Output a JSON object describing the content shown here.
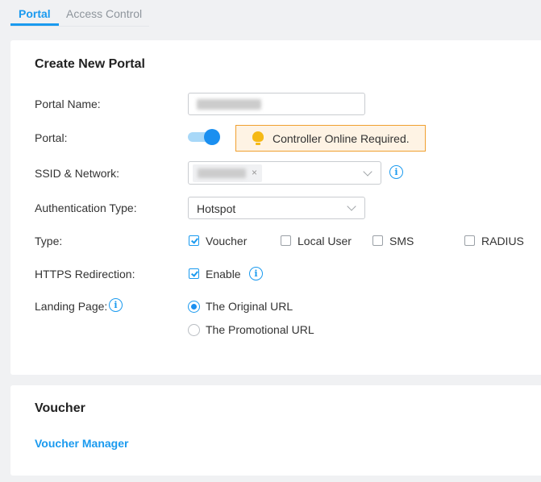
{
  "tabs": [
    {
      "label": "Portal",
      "active": true
    },
    {
      "label": "Access Control",
      "active": false
    }
  ],
  "create_portal": {
    "title": "Create New Portal",
    "portal_name": {
      "label": "Portal Name:",
      "value": "(blurred)"
    },
    "portal": {
      "label": "Portal:",
      "enabled": true,
      "warning": "Controller Online Required.",
      "warning_icon": "lightbulb-icon"
    },
    "ssid_network": {
      "label": "SSID & Network:",
      "selected_chips": [
        "(blurred)"
      ],
      "chip_remove": "×",
      "info_icon": "info-icon"
    },
    "auth_type": {
      "label": "Authentication Type:",
      "value": "Hotspot"
    },
    "type": {
      "label": "Type:",
      "options": [
        {
          "label": "Voucher",
          "checked": true
        },
        {
          "label": "Local User",
          "checked": false
        },
        {
          "label": "SMS",
          "checked": false
        },
        {
          "label": "RADIUS",
          "checked": false
        }
      ]
    },
    "https_redirection": {
      "label": "HTTPS Redirection:",
      "option": "Enable",
      "checked": true,
      "info_icon": "info-icon"
    },
    "landing_page": {
      "label": "Landing Page:",
      "info_icon": "info-icon",
      "options": [
        {
          "label": "The Original URL",
          "selected": true
        },
        {
          "label": "The Promotional URL",
          "selected": false
        }
      ]
    }
  },
  "voucher": {
    "title": "Voucher",
    "link": "Voucher Manager"
  },
  "colors": {
    "accent": "#1a9aef",
    "warning_bg": "#fef3e4",
    "warning_border": "#f0a030",
    "bulb": "#f5b915"
  }
}
